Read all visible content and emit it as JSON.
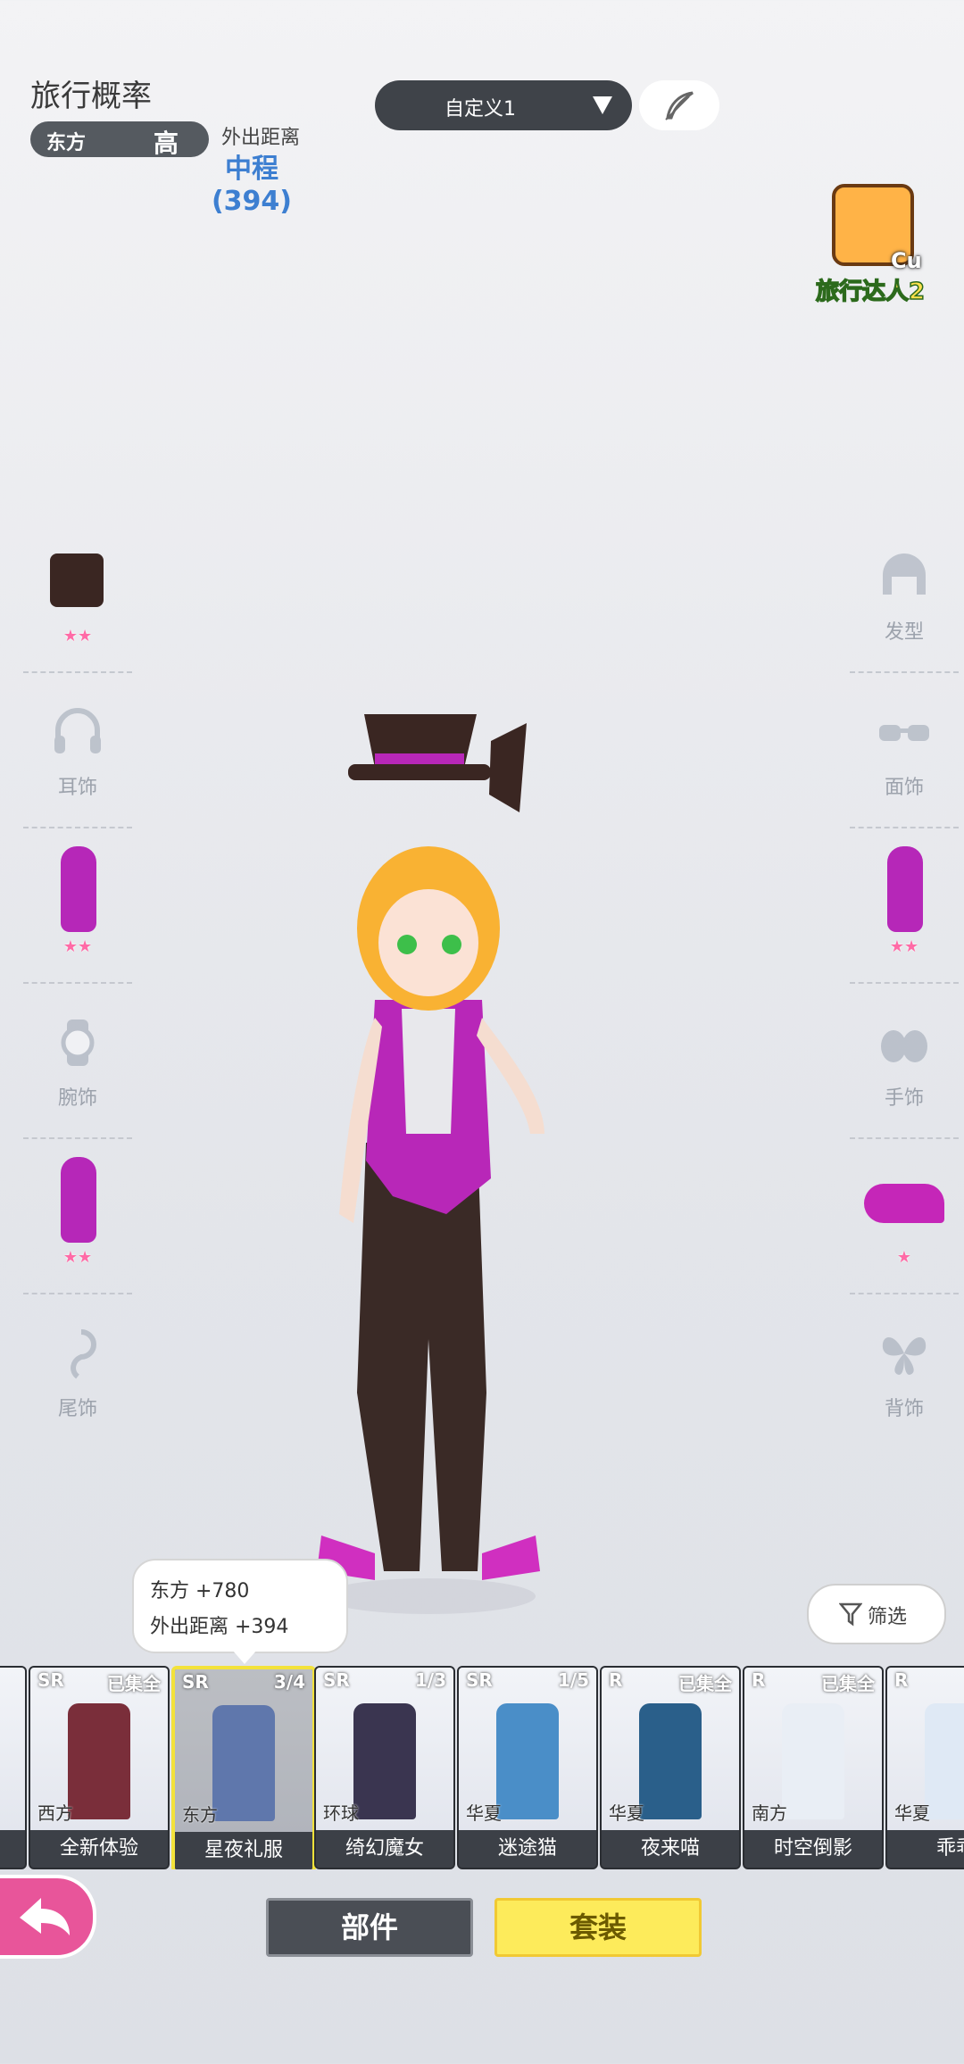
{
  "header": {
    "title": "旅行概率",
    "region": "东方",
    "region_level": "高",
    "distance_label": "外出距离",
    "distance_value": "中程",
    "distance_number": "(394)"
  },
  "preset": {
    "label": "自定义1"
  },
  "badge": {
    "tag": "Cu",
    "name": "旅行达人2"
  },
  "left_slots": [
    {
      "label": "",
      "stars": "★★",
      "equipped": "hat"
    },
    {
      "label": "耳饰"
    },
    {
      "label": "",
      "stars": "★★",
      "equipped": "vest"
    },
    {
      "label": "腕饰"
    },
    {
      "label": "",
      "stars": "★★",
      "equipped": "vest"
    },
    {
      "label": "尾饰"
    }
  ],
  "right_slots": [
    {
      "label": "发型"
    },
    {
      "label": "面饰"
    },
    {
      "label": "",
      "stars": "★★",
      "equipped": "vest"
    },
    {
      "label": "手饰"
    },
    {
      "label": "",
      "stars": "★",
      "equipped": "shoe"
    },
    {
      "label": "背饰"
    }
  ],
  "tooltip": {
    "line1": "东方 +780",
    "line2": "外出距离 +394"
  },
  "filter": {
    "label": "筛选"
  },
  "cards": [
    {
      "rarity": "SR",
      "count": "已集全",
      "region": "西方",
      "name": "全新体验",
      "color": "#7a2e3a"
    },
    {
      "rarity": "SR",
      "count": "3/4",
      "region": "东方",
      "name": "星夜礼服",
      "color": "#6f8fd8",
      "selected": true
    },
    {
      "rarity": "SR",
      "count": "1/3",
      "region": "环球",
      "name": "绮幻魔女",
      "color": "#3a3550"
    },
    {
      "rarity": "SR",
      "count": "1/5",
      "region": "华夏",
      "name": "迷途猫",
      "color": "#4a8ec8"
    },
    {
      "rarity": "R",
      "count": "已集全",
      "region": "华夏",
      "name": "夜来喵",
      "color": "#2a5f8a"
    },
    {
      "rarity": "R",
      "count": "已集全",
      "region": "南方",
      "name": "时空倒影",
      "color": "#e9eef5"
    },
    {
      "rarity": "R",
      "count": "",
      "region": "华夏",
      "name": "乖乖",
      "color": "#dfe9f5"
    }
  ],
  "tabs": {
    "parts": "部件",
    "sets": "套装"
  }
}
